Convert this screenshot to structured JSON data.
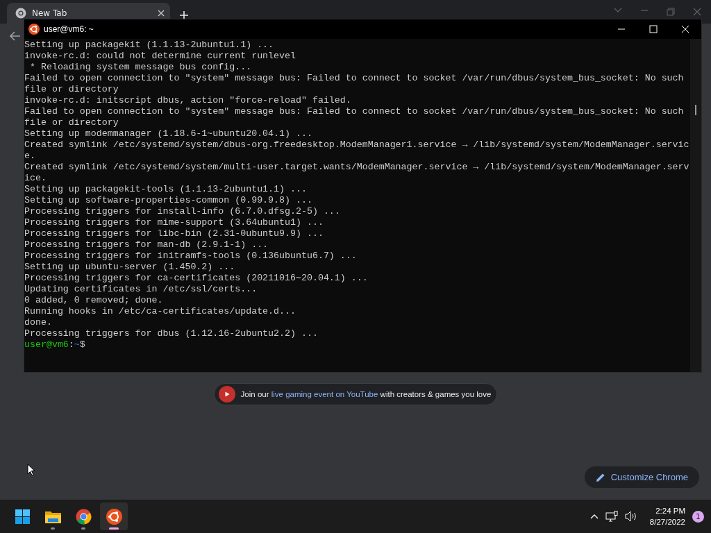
{
  "browser": {
    "tabs": [
      {
        "title": "New Tab",
        "selected": true
      }
    ],
    "promo": {
      "text_before": "Join our",
      "link": "live gaming event on YouTube",
      "text_after": "with creators & games you love"
    },
    "customize_button": "Customize Chrome"
  },
  "terminal": {
    "title": "user@vm6: ~",
    "lines": [
      "Setting up packagekit (1.1.13-2ubuntu1.1) ...",
      "invoke-rc.d: could not determine current runlevel",
      " * Reloading system message bus config...",
      "Failed to open connection to \"system\" message bus: Failed to connect to socket /var/run/dbus/system_bus_socket: No such",
      "file or directory",
      "invoke-rc.d: initscript dbus, action \"force-reload\" failed.",
      "Failed to open connection to \"system\" message bus: Failed to connect to socket /var/run/dbus/system_bus_socket: No such",
      "file or directory",
      "Setting up modemmanager (1.18.6-1~ubuntu20.04.1) ...",
      "Created symlink /etc/systemd/system/dbus-org.freedesktop.ModemManager1.service → /lib/systemd/system/ModemManager.servic",
      "e.",
      "Created symlink /etc/systemd/system/multi-user.target.wants/ModemManager.service → /lib/systemd/system/ModemManager.serv",
      "ice.",
      "Setting up packagekit-tools (1.1.13-2ubuntu1.1) ...",
      "Setting up software-properties-common (0.99.9.8) ...",
      "Processing triggers for install-info (6.7.0.dfsg.2-5) ...",
      "Processing triggers for mime-support (3.64ubuntu1) ...",
      "Processing triggers for libc-bin (2.31-0ubuntu9.9) ...",
      "Processing triggers for man-db (2.9.1-1) ...",
      "Processing triggers for initramfs-tools (0.136ubuntu6.7) ...",
      "Setting up ubuntu-server (1.450.2) ...",
      "Processing triggers for ca-certificates (20211016~20.04.1) ...",
      "Updating certificates in /etc/ssl/certs...",
      "0 added, 0 removed; done.",
      "Running hooks in /etc/ca-certificates/update.d...",
      "done.",
      "Processing triggers for dbus (1.12.16-2ubuntu2.2) ..."
    ],
    "prompt": {
      "user_host": "user@vm6",
      "separator": ":",
      "path": "~",
      "symbol": "$"
    }
  },
  "taskbar": {
    "apps": [
      {
        "kind": "start",
        "running": false,
        "selected": false
      },
      {
        "kind": "files",
        "running": true,
        "selected": false
      },
      {
        "kind": "browser",
        "running": true,
        "selected": false
      },
      {
        "kind": "terminal",
        "running": true,
        "selected": true
      }
    ],
    "time": "2:24 PM",
    "date": "8/27/2022",
    "notifications": "1"
  }
}
